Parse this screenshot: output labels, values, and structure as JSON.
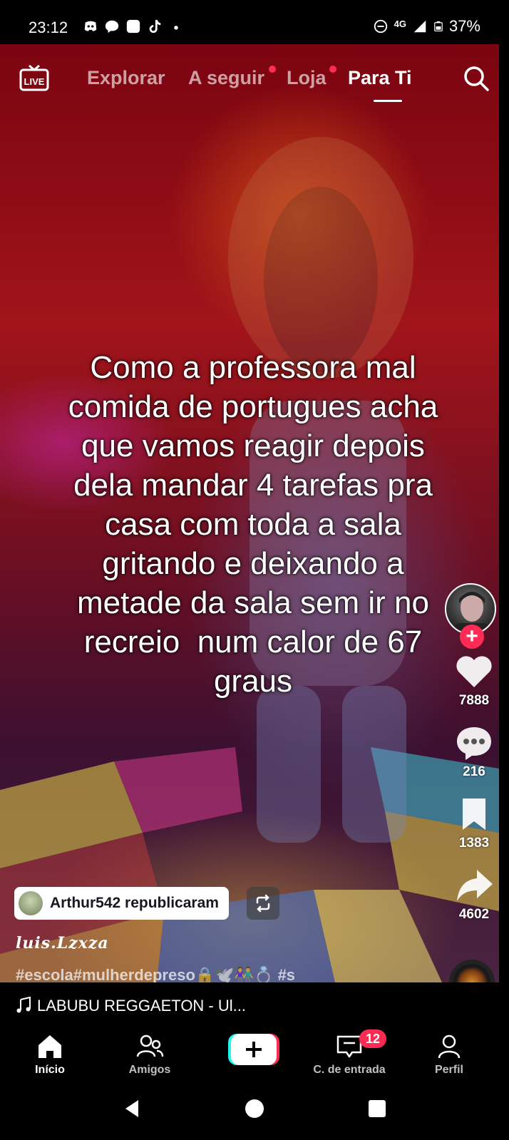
{
  "status_bar": {
    "time": "23:12",
    "network": "4G",
    "battery": "37%",
    "left_icons": [
      "discord-icon",
      "messenger-icon",
      "square-app-icon",
      "tiktok-icon",
      "dot-icon"
    ],
    "right_icons": [
      "do-not-disturb-icon",
      "signal-icon",
      "battery-icon"
    ]
  },
  "top_nav": {
    "live_label": "LIVE",
    "tabs": [
      {
        "label": "Explorar",
        "active": false,
        "has_dot": false
      },
      {
        "label": "A seguir",
        "active": false,
        "has_dot": true
      },
      {
        "label": "Loja",
        "active": false,
        "has_dot": true
      },
      {
        "label": "Para Ti",
        "active": true,
        "has_dot": false
      }
    ]
  },
  "video": {
    "caption": "Como a professora mal comida de portugues acha que vamos reagir depois dela mandar 4 tarefas pra casa com toda a sala gritando e deixando a metade da sala sem ir no recreio  num calor de 67 graus",
    "caption_lines": [
      "Como a professora mal",
      "comida de portugues acha",
      "que vamos reagir depois",
      "dela mandar 4 tarefas pra",
      "casa com toda a sala",
      "gritando e deixando a",
      "metade da sala sem ir no",
      "recreio  num calor de 67",
      "graus"
    ]
  },
  "actions": {
    "follow_label": "+",
    "likes": "7888",
    "comments": "216",
    "saves": "1383",
    "shares": "4602"
  },
  "repost": {
    "text": "Arthur542 republicaram"
  },
  "post": {
    "author": "luis.Lzxza",
    "hashtags": "#escola#mulherdepreso🔒🕊️👫💍 #s"
  },
  "music": {
    "title": "LABUBU REGGAETON - Ul..."
  },
  "bottom_nav": {
    "items": [
      {
        "label": "Início",
        "icon": "home-icon",
        "active": true
      },
      {
        "label": "Amigos",
        "icon": "friends-icon",
        "active": false
      },
      {
        "label": "",
        "icon": "add-icon",
        "active": false
      },
      {
        "label": "C. de entrada",
        "icon": "inbox-icon",
        "active": false
      },
      {
        "label": "Perfil",
        "icon": "profile-icon",
        "active": false
      }
    ],
    "inbox_badge": "12",
    "add_label": "+"
  },
  "colors": {
    "accent": "#fe2c55",
    "cyan": "#25f4ee",
    "background": "#000000"
  }
}
